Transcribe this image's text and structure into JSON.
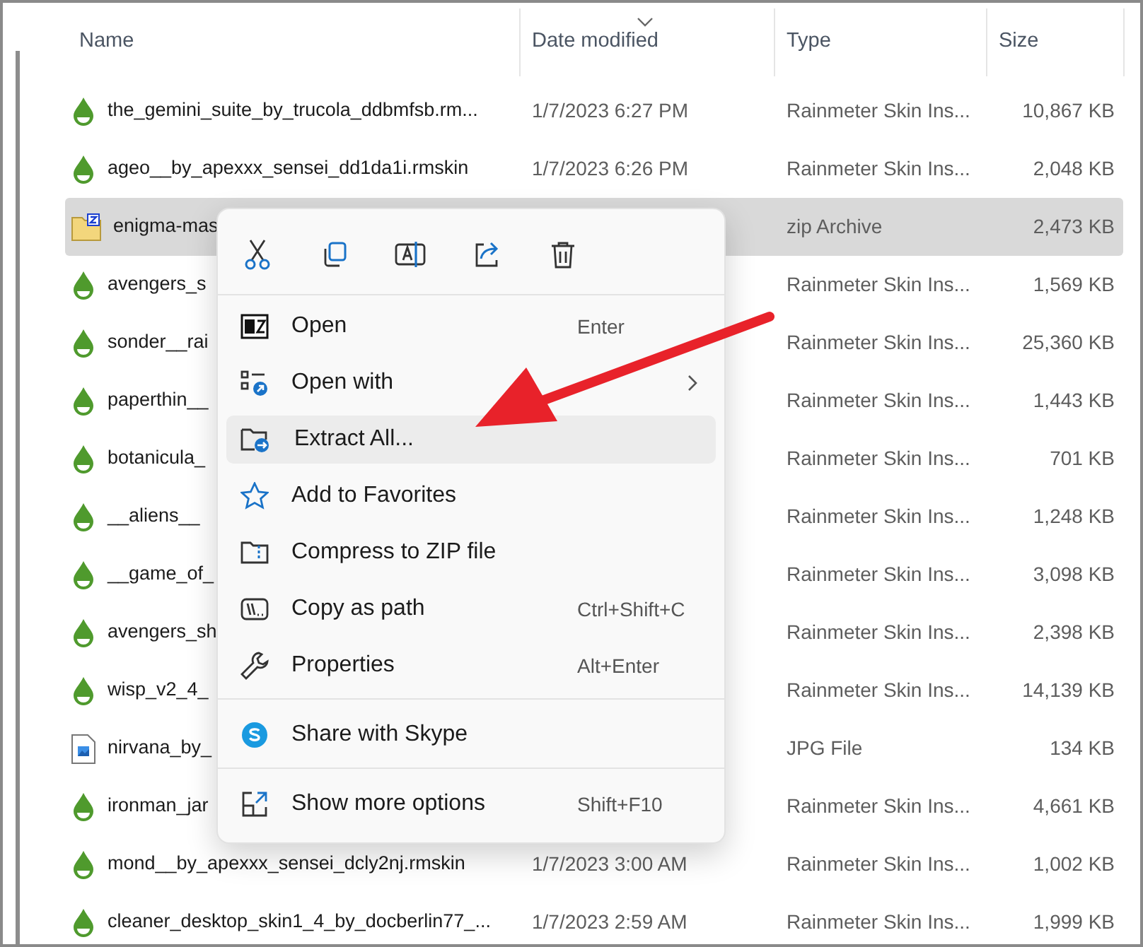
{
  "columns": [
    {
      "label": "Name",
      "sorted": false
    },
    {
      "label": "Date modified",
      "sorted": true
    },
    {
      "label": "Type",
      "sorted": false
    },
    {
      "label": "Size",
      "sorted": false
    }
  ],
  "rows": [
    {
      "kind": "rmskin",
      "name": "the_gemini_suite_by_trucola_ddbmfsb.rm...",
      "date": "1/7/2023 6:27 PM",
      "type": "Rainmeter Skin Ins...",
      "size": "10,867 KB",
      "selected": false
    },
    {
      "kind": "rmskin",
      "name": "ageo__by_apexxx_sensei_dd1da1i.rmskin",
      "date": "1/7/2023 6:26 PM",
      "type": "Rainmeter Skin Ins...",
      "size": "2,048 KB",
      "selected": false
    },
    {
      "kind": "zip",
      "name": "enigma-mas",
      "type": "zip Archive",
      "size": "2,473 KB",
      "selected": true
    },
    {
      "kind": "rmskin",
      "name": "avengers_s",
      "type": "Rainmeter Skin Ins...",
      "size": "1,569 KB",
      "selected": false
    },
    {
      "kind": "rmskin",
      "name": "sonder__rai",
      "type": "Rainmeter Skin Ins...",
      "size": "25,360 KB",
      "selected": false
    },
    {
      "kind": "rmskin",
      "name": "paperthin__",
      "type": "Rainmeter Skin Ins...",
      "size": "1,443 KB",
      "selected": false
    },
    {
      "kind": "rmskin",
      "name": "botanicula_",
      "type": "Rainmeter Skin Ins...",
      "size": "701 KB",
      "selected": false
    },
    {
      "kind": "rmskin",
      "name": "__aliens__",
      "type": "Rainmeter Skin Ins...",
      "size": "1,248 KB",
      "selected": false
    },
    {
      "kind": "rmskin",
      "name": "__game_of_",
      "type": "Rainmeter Skin Ins...",
      "size": "3,098 KB",
      "selected": false
    },
    {
      "kind": "rmskin",
      "name": "avengers_sh",
      "type": "Rainmeter Skin Ins...",
      "size": "2,398 KB",
      "selected": false
    },
    {
      "kind": "rmskin",
      "name": "wisp_v2_4_",
      "type": "Rainmeter Skin Ins...",
      "size": "14,139 KB",
      "selected": false
    },
    {
      "kind": "image",
      "name": "nirvana_by_",
      "type": "JPG File",
      "size": "134 KB",
      "selected": false
    },
    {
      "kind": "rmskin",
      "name": "ironman_jar",
      "type": "Rainmeter Skin Ins...",
      "size": "4,661 KB",
      "selected": false
    },
    {
      "kind": "rmskin",
      "name": "mond__by_apexxx_sensei_dcly2nj.rmskin",
      "date": "1/7/2023 3:00 AM",
      "type": "Rainmeter Skin Ins...",
      "size": "1,002 KB",
      "selected": false
    },
    {
      "kind": "rmskin",
      "name": "cleaner_desktop_skin1_4_by_docberlin77_...",
      "date": "1/7/2023 2:59 AM",
      "type": "Rainmeter Skin Ins...",
      "size": "1,999 KB",
      "selected": false
    }
  ],
  "context_menu": {
    "toolbar": [
      {
        "kind": "cut"
      },
      {
        "kind": "copy"
      },
      {
        "kind": "rename"
      },
      {
        "kind": "share"
      },
      {
        "kind": "delete"
      }
    ],
    "sections": [
      [
        {
          "kind": "sevenzip",
          "label": "Open",
          "shortcut": "Enter",
          "submenu": false,
          "selected": false
        },
        {
          "kind": "openwith",
          "label": "Open with",
          "submenu": true,
          "selected": false
        },
        {
          "kind": "extract",
          "label": "Extract All...",
          "submenu": false,
          "selected": true
        },
        {
          "kind": "star",
          "label": "Add to Favorites",
          "submenu": false,
          "selected": false
        },
        {
          "kind": "compress",
          "label": "Compress to ZIP file",
          "submenu": false,
          "selected": false
        },
        {
          "kind": "path",
          "label": "Copy as path",
          "shortcut": "Ctrl+Shift+C",
          "submenu": false,
          "selected": false
        },
        {
          "kind": "wrench",
          "label": "Properties",
          "shortcut": "Alt+Enter",
          "submenu": false,
          "selected": false
        }
      ],
      [
        {
          "kind": "skype",
          "label": "Share with Skype",
          "submenu": false,
          "selected": false
        }
      ],
      [
        {
          "kind": "more",
          "label": "Show more options",
          "shortcut": "Shift+F10",
          "submenu": false,
          "selected": false
        }
      ]
    ]
  }
}
